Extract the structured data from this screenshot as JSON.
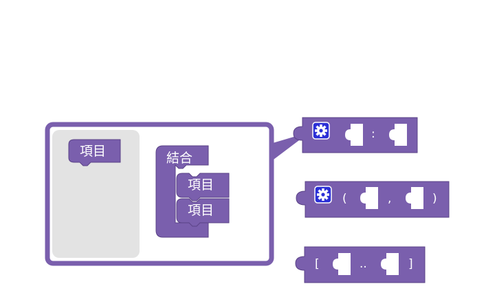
{
  "mutator": {
    "palette_item_label": "項目",
    "container_label": "結合",
    "inner_item_1_label": "項目",
    "inner_item_2_label": "項目"
  },
  "blocks": {
    "pair_separator": ":",
    "tuple_open": "(",
    "tuple_separator": ",",
    "tuple_close": ")",
    "range_open": "[",
    "range_separator": "..",
    "range_close": "]"
  },
  "colors": {
    "block": "#7a5fad",
    "block_dark": "#5b4387",
    "gear_bg": "#2b2fd6",
    "palette_bg": "#e3e3e3"
  },
  "icons": {
    "mutator_gear": "gear-icon"
  }
}
